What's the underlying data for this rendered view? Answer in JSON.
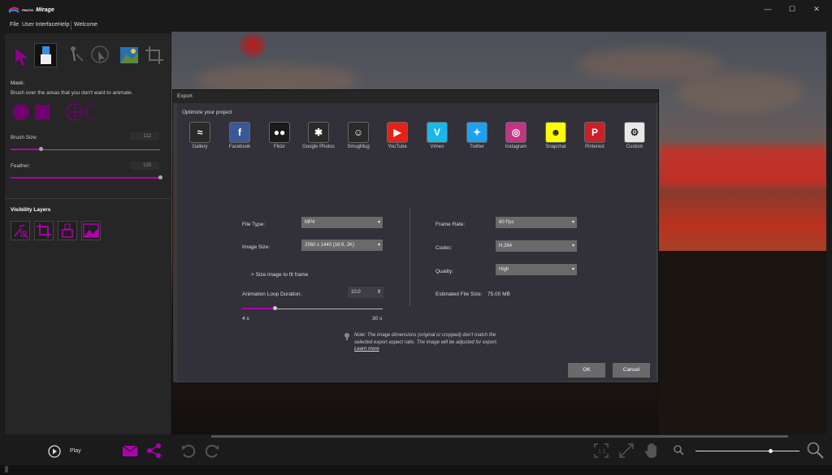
{
  "app": {
    "brand_small": "PHOTO",
    "brand_main": "Mirage",
    "window_controls": [
      "—",
      "☐",
      "✕"
    ]
  },
  "menu": {
    "items": [
      "File",
      "User Interface",
      "Help",
      "Welcome"
    ]
  },
  "sidebar": {
    "mask_heading": "Mask:",
    "mask_hint": "Brush over the areas that you don't want to animate.",
    "brush_size_label": "Brush Size:",
    "brush_size_value": "112",
    "brush_size_fraction": 0.2,
    "feather_label": "Feather:",
    "feather_value": "100",
    "feather_fraction": 1.0,
    "visibility_heading": "Visibility Layers"
  },
  "dialog": {
    "title": "Export",
    "optimize_label": "Optimize your project",
    "targets": [
      {
        "label": "Gallery",
        "color": "#2a2a2a",
        "glyph": "≈"
      },
      {
        "label": "Facebook",
        "color": "#3b5998",
        "glyph": "f"
      },
      {
        "label": "Flickr",
        "color": "#1a1a1a",
        "glyph": "●●"
      },
      {
        "label": "Google Photos",
        "color": "#2a2a2a",
        "glyph": "✱"
      },
      {
        "label": "SmugMug",
        "color": "#2a2a2a",
        "glyph": "☺"
      },
      {
        "label": "YouTube",
        "color": "#e62117",
        "glyph": "▶"
      },
      {
        "label": "Vimeo",
        "color": "#1ab7ea",
        "glyph": "V"
      },
      {
        "label": "Twitter",
        "color": "#1da1f2",
        "glyph": "✦"
      },
      {
        "label": "Instagram",
        "color": "#c13584",
        "glyph": "◎"
      },
      {
        "label": "Snapchat",
        "color": "#fffc00",
        "glyph": "☻"
      },
      {
        "label": "Pinterest",
        "color": "#cb2027",
        "glyph": "P"
      },
      {
        "label": "Custom",
        "color": "#e8e8e8",
        "glyph": "⚙"
      }
    ],
    "file_type_label": "File Type:",
    "file_type_value": "MP4",
    "image_size_label": "Image Size:",
    "image_size_value": "2560 x 1440 (16:9, 2K)",
    "size_to_fit_label": "Size image to fit frame",
    "loop_duration_label": "Animation Loop Duration:",
    "loop_duration_value": "10.0",
    "loop_min": "4 s",
    "loop_max": "30 s",
    "loop_fraction": 0.23,
    "frame_rate_label": "Frame Rate:",
    "frame_rate_value": "60 Fps",
    "codec_label": "Codec:",
    "codec_value": "H.264",
    "quality_label": "Quality:",
    "quality_value": "High",
    "est_size_label": "Estimated File Size:",
    "est_size_value": "75.00 MB",
    "note": "Note: The image dimensions (original or cropped) don't match the selected export aspect ratio. The image will be adjusted for export.",
    "learn_more": "Learn more",
    "ok_label": "OK",
    "cancel_label": "Cancel"
  },
  "bottom": {
    "play_label": "Play",
    "zoom_fraction": 0.72
  },
  "colors": {
    "accent": "#b000b0"
  }
}
